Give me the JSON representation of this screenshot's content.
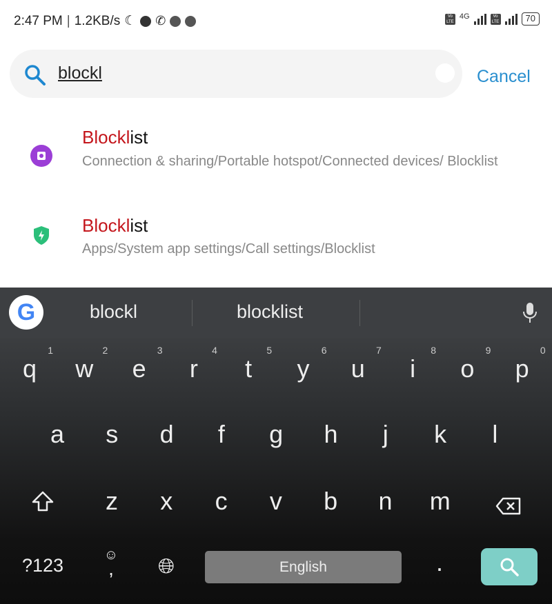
{
  "status_bar": {
    "time": "2:47 PM",
    "speed": "1.2KB/s",
    "network": "4G",
    "volte": "Vo LTE",
    "battery": "70",
    "icons": [
      "moon-icon",
      "alarm-icon",
      "whatsapp-icon",
      "snapchat-icon",
      "snapchat-icon"
    ]
  },
  "search": {
    "query": "blockl",
    "cancel_label": "Cancel"
  },
  "results": [
    {
      "title_match": "Blockl",
      "title_rest": "ist",
      "path": "Connection & sharing/Portable hotspot/Connected devices/ Blocklist",
      "icon": "hotspot-settings-icon",
      "icon_color": "#9b3ed6"
    },
    {
      "title_match": "Blockl",
      "title_rest": "ist",
      "path": "Apps/System app settings/Call settings/Blocklist",
      "icon": "security-shield-icon",
      "icon_color": "#2bbf7a"
    }
  ],
  "keyboard": {
    "suggestions": [
      "blockl",
      "blocklist"
    ],
    "row1": [
      "q",
      "w",
      "e",
      "r",
      "t",
      "y",
      "u",
      "i",
      "o",
      "p"
    ],
    "row1_nums": [
      "1",
      "2",
      "3",
      "4",
      "5",
      "6",
      "7",
      "8",
      "9",
      "0"
    ],
    "row2": [
      "a",
      "s",
      "d",
      "f",
      "g",
      "h",
      "j",
      "k",
      "l"
    ],
    "row3": [
      "z",
      "x",
      "c",
      "v",
      "b",
      "n",
      "m"
    ],
    "symbols_label": "?123",
    "comma": ",",
    "period": ".",
    "space_label": "English",
    "enter_color": "#7ecfc7"
  }
}
